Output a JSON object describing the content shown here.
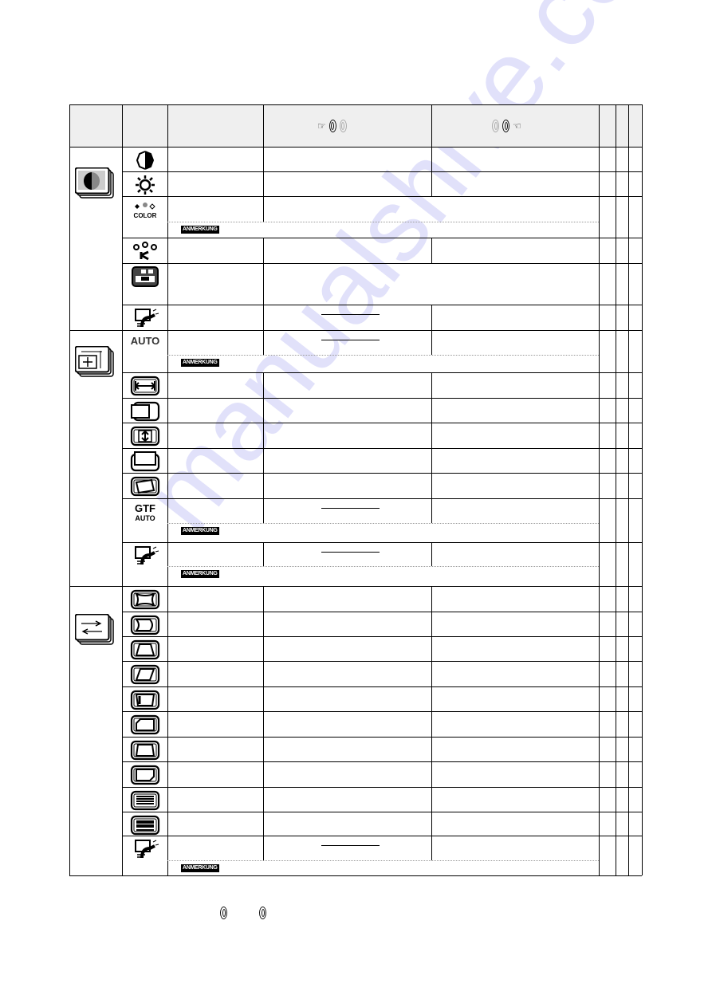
{
  "page": {
    "watermark": "manualshive.com"
  },
  "table": {
    "header": {
      "col_minus_buttons": {
        "hand_icon": "pointing-hand-right",
        "active": "minus-button",
        "inactive": "plus-button"
      },
      "col_plus_buttons": {
        "hand_icon": "pointing-hand-left",
        "inactive": "minus-button",
        "active": "plus-button"
      }
    },
    "note_label": "ANMERKUNG",
    "sections": [
      {
        "name": "picture",
        "icon": "picture-menu-icon",
        "rows": [
          {
            "icon": "contrast-icon"
          },
          {
            "icon": "brightness-icon"
          },
          {
            "icon": "color-icon",
            "icon_text": "COLOR",
            "merged": true,
            "note": true
          },
          {
            "icon": "rgb-k-icon"
          },
          {
            "icon": "movie-mode-icon",
            "merged": true
          },
          {
            "icon": "picture-reset-icon",
            "blank": true
          }
        ]
      },
      {
        "name": "geometry",
        "icon": "size-position-menu-icon",
        "rows": [
          {
            "icon": "auto-adjust-icon",
            "icon_text": "AUTO",
            "blank": true,
            "note": true
          },
          {
            "icon": "h-size-icon"
          },
          {
            "icon": "h-position-icon"
          },
          {
            "icon": "v-size-icon"
          },
          {
            "icon": "v-position-icon"
          },
          {
            "icon": "rotation-icon"
          },
          {
            "icon": "gtf-auto-icon",
            "icon_text": "GTF",
            "icon_text2": "AUTO",
            "blank": true,
            "note": true
          },
          {
            "icon": "geometry-reset-icon",
            "blank": true,
            "note": true
          }
        ]
      },
      {
        "name": "distortion",
        "icon": "distortion-menu-icon",
        "rows": [
          {
            "icon": "pincushion-icon"
          },
          {
            "icon": "pincushion-balance-icon"
          },
          {
            "icon": "trapezoid-icon"
          },
          {
            "icon": "parallelogram-icon"
          },
          {
            "icon": "top-corner-icon"
          },
          {
            "icon": "top-corner-balance-icon"
          },
          {
            "icon": "bottom-corner-icon"
          },
          {
            "icon": "bottom-corner-balance-icon"
          },
          {
            "icon": "moire-h-icon"
          },
          {
            "icon": "moire-v-icon"
          },
          {
            "icon": "distortion-reset-icon",
            "blank": true,
            "note": true
          }
        ]
      }
    ]
  },
  "footer": {
    "buttons": [
      "minus-button",
      "plus-button"
    ]
  }
}
